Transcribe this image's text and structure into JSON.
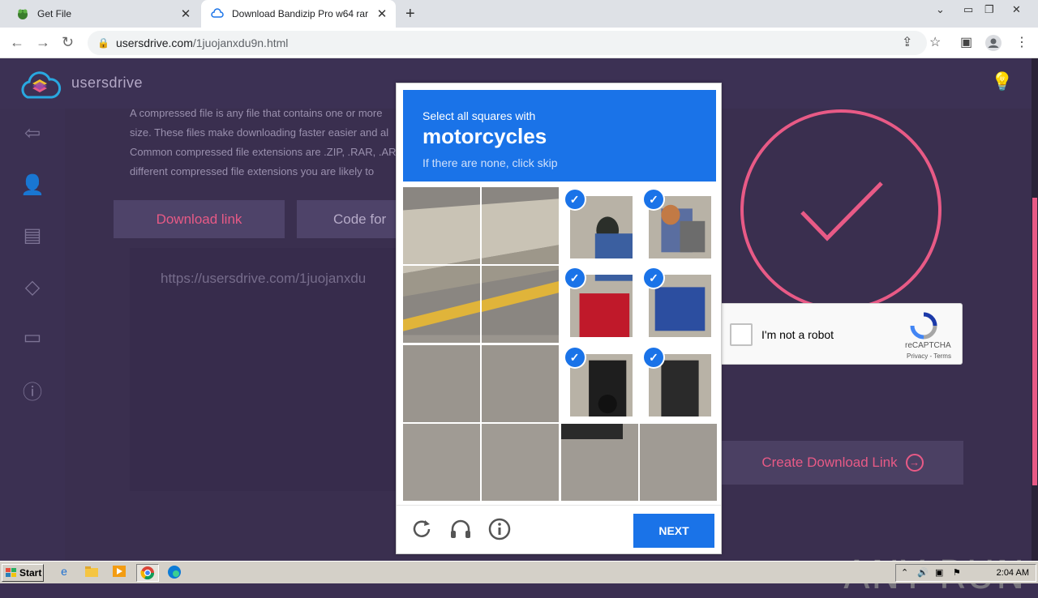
{
  "browser": {
    "tabs": [
      {
        "title": "Get File",
        "active": false
      },
      {
        "title": "Download Bandizip Pro w64 rar",
        "active": true
      }
    ],
    "new_tab": "+",
    "url_host": "usersdrive.com",
    "url_path": "/1juojanxdu9n.html"
  },
  "site": {
    "brand": "usersdrive",
    "paragraph": "A compressed file is any file that contains one or more size. These files make downloading faster easier and al Common compressed file extensions are .ZIP, .RAR, .AR different compressed file extensions you are likely to",
    "download_link_button": "Download link",
    "code_for_button": "Code for",
    "link_text": "https://usersdrive.com/1juojanxdu",
    "create_download_link": "Create Download Link",
    "accent_color": "#e85a86"
  },
  "recaptcha_anchor": {
    "label": "I'm not a robot",
    "brand": "reCAPTCHA",
    "terms": "Privacy - Terms"
  },
  "challenge": {
    "instruction": "Select all squares with",
    "target": "motorcycles",
    "hint": "If there are none, click skip",
    "next_button": "NEXT",
    "selected_tiles": [
      2,
      3,
      6,
      7,
      10,
      11
    ],
    "check_mark": "✓"
  },
  "watermark": "ANY RUN",
  "taskbar": {
    "start": "Start",
    "clock": "2:04 AM"
  }
}
